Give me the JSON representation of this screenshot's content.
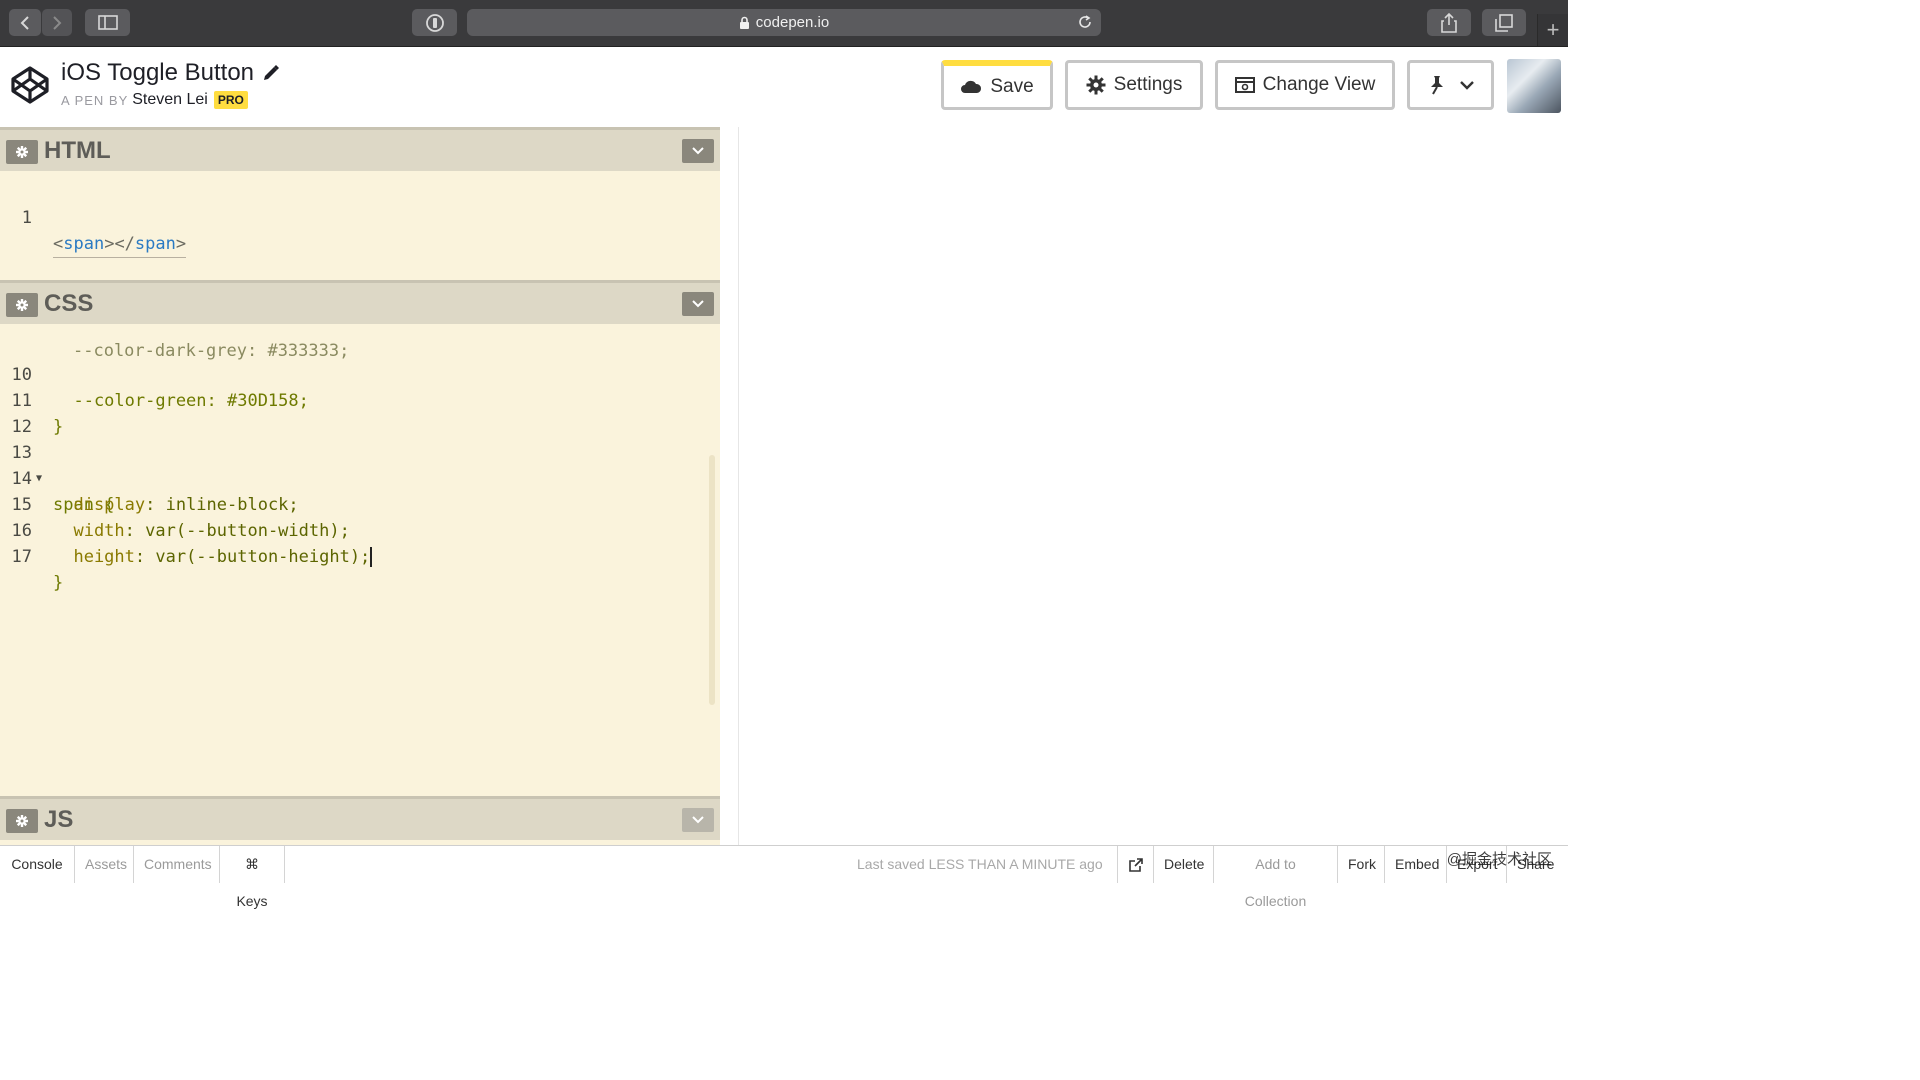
{
  "browser": {
    "url": "codepen.io",
    "icons": [
      "back-icon",
      "forward-icon",
      "sidebar-icon",
      "password-icon",
      "lock-icon",
      "reload-icon",
      "share-icon",
      "tabs-icon",
      "new-tab-icon"
    ]
  },
  "header": {
    "pen_title": "iOS Toggle Button",
    "pen_by": "A PEN BY",
    "author": "Steven Lei",
    "badge": "PRO",
    "save_label": "Save",
    "settings_label": "Settings",
    "change_view_label": "Change View",
    "accent_color": "#ffdd40"
  },
  "editors": {
    "html": {
      "name": "HTML",
      "lines": [
        {
          "n": "1",
          "open": "<",
          "tag": "span",
          "mid": "></",
          "tag2": "span",
          "close": ">"
        }
      ]
    },
    "css": {
      "name": "CSS",
      "partial_top": "--color-dark-grey: #333333;",
      "lines": [
        {
          "n": "10",
          "text": "  --color-green: #30D158;"
        },
        {
          "n": "11",
          "text": "}"
        },
        {
          "n": "12",
          "text": ""
        },
        {
          "n": "13",
          "text": "span {"
        },
        {
          "n": "14",
          "prop": "  display",
          "val": ": inline-block;"
        },
        {
          "n": "15",
          "prop": "  width",
          "val": ": var(--button-width);"
        },
        {
          "n": "16",
          "prop": "  height",
          "val": ": var(--button-height);"
        },
        {
          "n": "17",
          "text": "}"
        }
      ]
    },
    "js": {
      "name": "JS"
    }
  },
  "footer": {
    "console": "Console",
    "assets": "Assets",
    "comments": "Comments",
    "keys": "⌘ Keys",
    "saved": "Last saved LESS THAN A MINUTE ago",
    "delete": "Delete",
    "add_to_collection": "Add to Collection",
    "fork": "Fork",
    "embed": "Embed",
    "export": "Export",
    "share": "Share",
    "watermark": "@掘金技术社区"
  }
}
